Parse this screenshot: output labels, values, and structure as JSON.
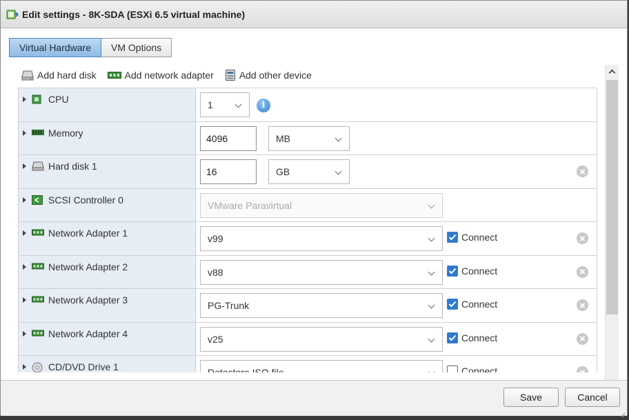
{
  "window": {
    "title": "Edit settings - 8K-SDA (ESXi 6.5 virtual machine)",
    "title_icon": "vm-settings-icon"
  },
  "tabs": [
    {
      "label": "Virtual Hardware",
      "active": true
    },
    {
      "label": "VM Options",
      "active": false
    }
  ],
  "toolbar": {
    "add_hard_disk": "Add hard disk",
    "add_network_adapter": "Add network adapter",
    "add_other_device": "Add other device"
  },
  "devices": {
    "cpu": {
      "label": "CPU",
      "value": "1"
    },
    "memory": {
      "label": "Memory",
      "value": "4096",
      "unit": "MB"
    },
    "hard_disk_1": {
      "label": "Hard disk 1",
      "value": "16",
      "unit": "GB"
    },
    "scsi": {
      "label": "SCSI Controller 0",
      "value": "VMware Paravirtual"
    },
    "net1": {
      "label": "Network Adapter 1",
      "value": "v99",
      "connect_label": "Connect",
      "connected": true
    },
    "net2": {
      "label": "Network Adapter 2",
      "value": "v88",
      "connect_label": "Connect",
      "connected": true
    },
    "net3": {
      "label": "Network Adapter 3",
      "value": "PG-Trunk",
      "connect_label": "Connect",
      "connected": true
    },
    "net4": {
      "label": "Network Adapter 4",
      "value": "v25",
      "connect_label": "Connect",
      "connected": true
    },
    "cd1": {
      "label": "CD/DVD Drive 1",
      "value": "Datastore ISO file",
      "connect_label": "Connect",
      "connected": false
    }
  },
  "footer": {
    "save_label": "Save",
    "cancel_label": "Cancel"
  },
  "colors": {
    "accent": "#2f7ad0",
    "row_label_bg": "#e6edf5",
    "tab_active": "#a6cbee"
  }
}
